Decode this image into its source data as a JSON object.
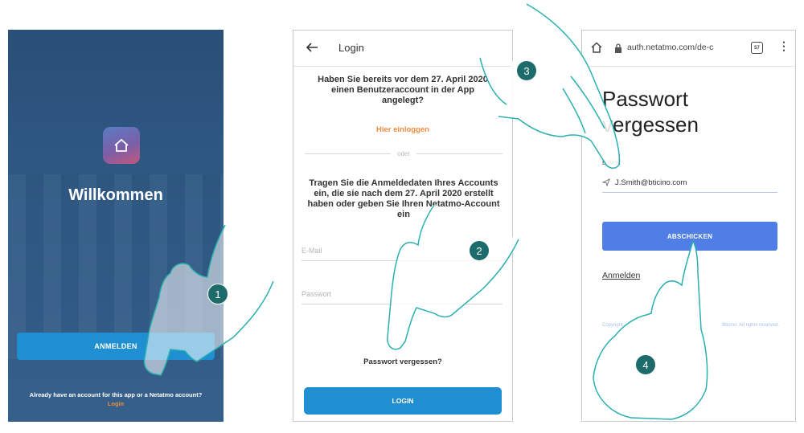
{
  "welcome_screen": {
    "title": "Willkommen",
    "button_label": "ANMELDEN",
    "footer_text": "Already have an account for this app or a Netatmo account?",
    "footer_link": "Login"
  },
  "login_screen": {
    "title": "Login",
    "question": "Haben Sie bereits vor dem 27. April 2020 einen Benutzeraccount in der App angelegt?",
    "existing_link": "Hier einloggen",
    "separator": "oder",
    "description": "Tragen Sie die Anmeldedaten Ihres Accounts ein, die sie nach dem 27. April 2020 erstellt haben oder geben Sie Ihren Netatmo-Account ein",
    "email_placeholder": "E-Mail",
    "password_placeholder": "Passwort",
    "forgot_link": "Passwort vergessen?",
    "login_button": "LOGIN"
  },
  "reset_screen": {
    "url": "auth.netatmo.com/de-c",
    "tab_count": "57",
    "title_line1": "Passwort",
    "title_line2": "vergessen",
    "email_label": "E-Mail",
    "email_value": "J.Smith@bticino.com",
    "submit_button": "ABSCHICKEN",
    "signin_link": "Anmelden",
    "copyright_left": "Copyright",
    "copyright_right": "Bticino. All rights reserved."
  },
  "steps": [
    "1",
    "2",
    "3",
    "4"
  ],
  "colors": {
    "primary_blue": "#1f8fd1",
    "submit_blue": "#4f7fe6",
    "orange_link": "#f08a3c",
    "badge_teal": "#1d6b6b",
    "welcome_bg": "#2f5a85"
  },
  "icons": [
    "home-icon",
    "back-arrow-icon",
    "lock-icon",
    "tabs-icon",
    "menu-dots-icon",
    "send-icon"
  ]
}
